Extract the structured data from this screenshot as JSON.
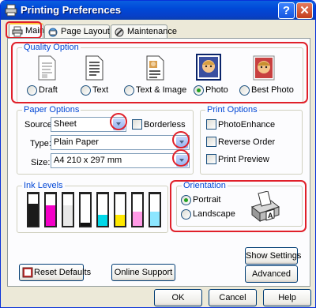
{
  "window": {
    "title": "Printing Preferences",
    "help_glyph": "?",
    "close_glyph": "✕"
  },
  "tabs": [
    {
      "label": "Main",
      "icon": "printer-icon",
      "active": true
    },
    {
      "label": "Page Layout",
      "icon": "page-layout-icon",
      "active": false
    },
    {
      "label": "Maintenance",
      "icon": "maintenance-icon",
      "active": false
    }
  ],
  "quality": {
    "title": "Quality Option",
    "options": [
      {
        "label": "Draft",
        "selected": false,
        "icon": "draft-doc-icon"
      },
      {
        "label": "Text",
        "selected": false,
        "icon": "text-doc-icon"
      },
      {
        "label": "Text & Image",
        "selected": false,
        "icon": "text-image-doc-icon"
      },
      {
        "label": "Photo",
        "selected": true,
        "icon": "photo-icon"
      },
      {
        "label": "Best Photo",
        "selected": false,
        "icon": "best-photo-icon"
      }
    ]
  },
  "paper": {
    "title": "Paper Options",
    "source_label": "Source:",
    "source_value": "Sheet",
    "borderless_label": "Borderless",
    "type_label": "Type:",
    "type_value": "Plain Paper",
    "size_label": "Size:",
    "size_value": "A4 210 x 297 mm"
  },
  "print_options": {
    "title": "Print Options",
    "items": [
      "PhotoEnhance",
      "Reverse Order",
      "Print Preview"
    ]
  },
  "ink": {
    "title": "Ink Levels",
    "levels": [
      {
        "color": "#1a1a1a",
        "level": 0.7
      },
      {
        "color": "#f400c8",
        "level": 0.65
      },
      {
        "color": "#e8e8e8",
        "level": 0.65
      },
      {
        "color": "#111111",
        "level": 0.1
      },
      {
        "color": "#00d8e8",
        "level": 0.35
      },
      {
        "color": "#ffe800",
        "level": 0.35
      },
      {
        "color": "#ff9ae6",
        "level": 0.45
      },
      {
        "color": "#8ce6ff",
        "level": 0.45
      }
    ]
  },
  "orientation": {
    "title": "Orientation",
    "portrait": "Portrait",
    "landscape": "Landscape",
    "selected": "Portrait"
  },
  "buttons": {
    "show_settings": "Show Settings",
    "advanced": "Advanced",
    "reset_defaults": "Reset Defaults",
    "online_support": "Online Support",
    "ok": "OK",
    "cancel": "Cancel",
    "help": "Help"
  },
  "colors": {
    "accent_red": "#e0202a",
    "group_title": "#0046d5",
    "titlebar": "#0049d8"
  }
}
